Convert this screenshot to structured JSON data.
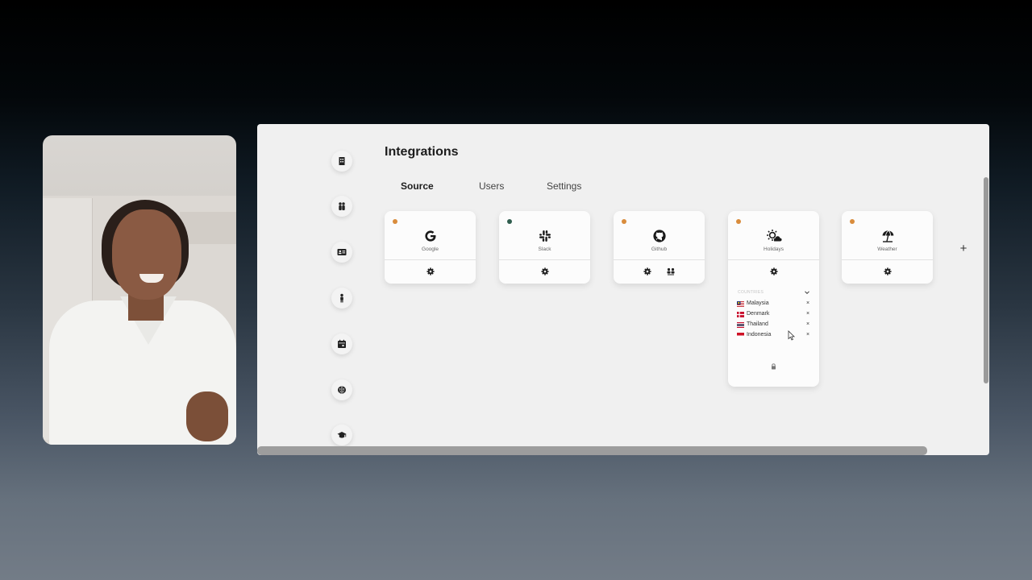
{
  "page": {
    "title": "Integrations"
  },
  "tabs": [
    {
      "label": "Source",
      "active": true
    },
    {
      "label": "Users",
      "active": false
    },
    {
      "label": "Settings",
      "active": false
    }
  ],
  "sidebar": {
    "items": [
      {
        "icon": "building-icon"
      },
      {
        "icon": "people-icon"
      },
      {
        "icon": "id-card-icon"
      },
      {
        "icon": "person-icon"
      },
      {
        "icon": "calendar-icon"
      },
      {
        "icon": "brain-icon"
      },
      {
        "icon": "graduation-cap-icon"
      }
    ]
  },
  "integrations": [
    {
      "name": "Google",
      "status_color": "#d98c3c",
      "icon": "google-logo-icon",
      "actions": [
        "gear-icon"
      ]
    },
    {
      "name": "Slack",
      "status_color": "#2f5d4e",
      "icon": "slack-logo-icon",
      "actions": [
        "gear-icon"
      ]
    },
    {
      "name": "Github",
      "status_color": "#d98c3c",
      "icon": "github-logo-icon",
      "actions": [
        "gear-icon",
        "users-sync-icon"
      ]
    },
    {
      "name": "Holidays",
      "status_color": "#d98c3c",
      "icon": "sun-cloud-icon",
      "actions": [
        "gear-icon"
      ],
      "countries_header": "COUNTRIES",
      "countries": [
        {
          "name": "Malaysia",
          "flag": "malaysia-flag-icon"
        },
        {
          "name": "Denmark",
          "flag": "denmark-flag-icon"
        },
        {
          "name": "Thailand",
          "flag": "thailand-flag-icon"
        },
        {
          "name": "Indonesia",
          "flag": "indonesia-flag-icon"
        }
      ],
      "remove_label": "×"
    },
    {
      "name": "Weather",
      "status_color": "#d98c3c",
      "icon": "beach-umbrella-icon",
      "actions": [
        "gear-icon"
      ]
    }
  ],
  "add_label": "+"
}
